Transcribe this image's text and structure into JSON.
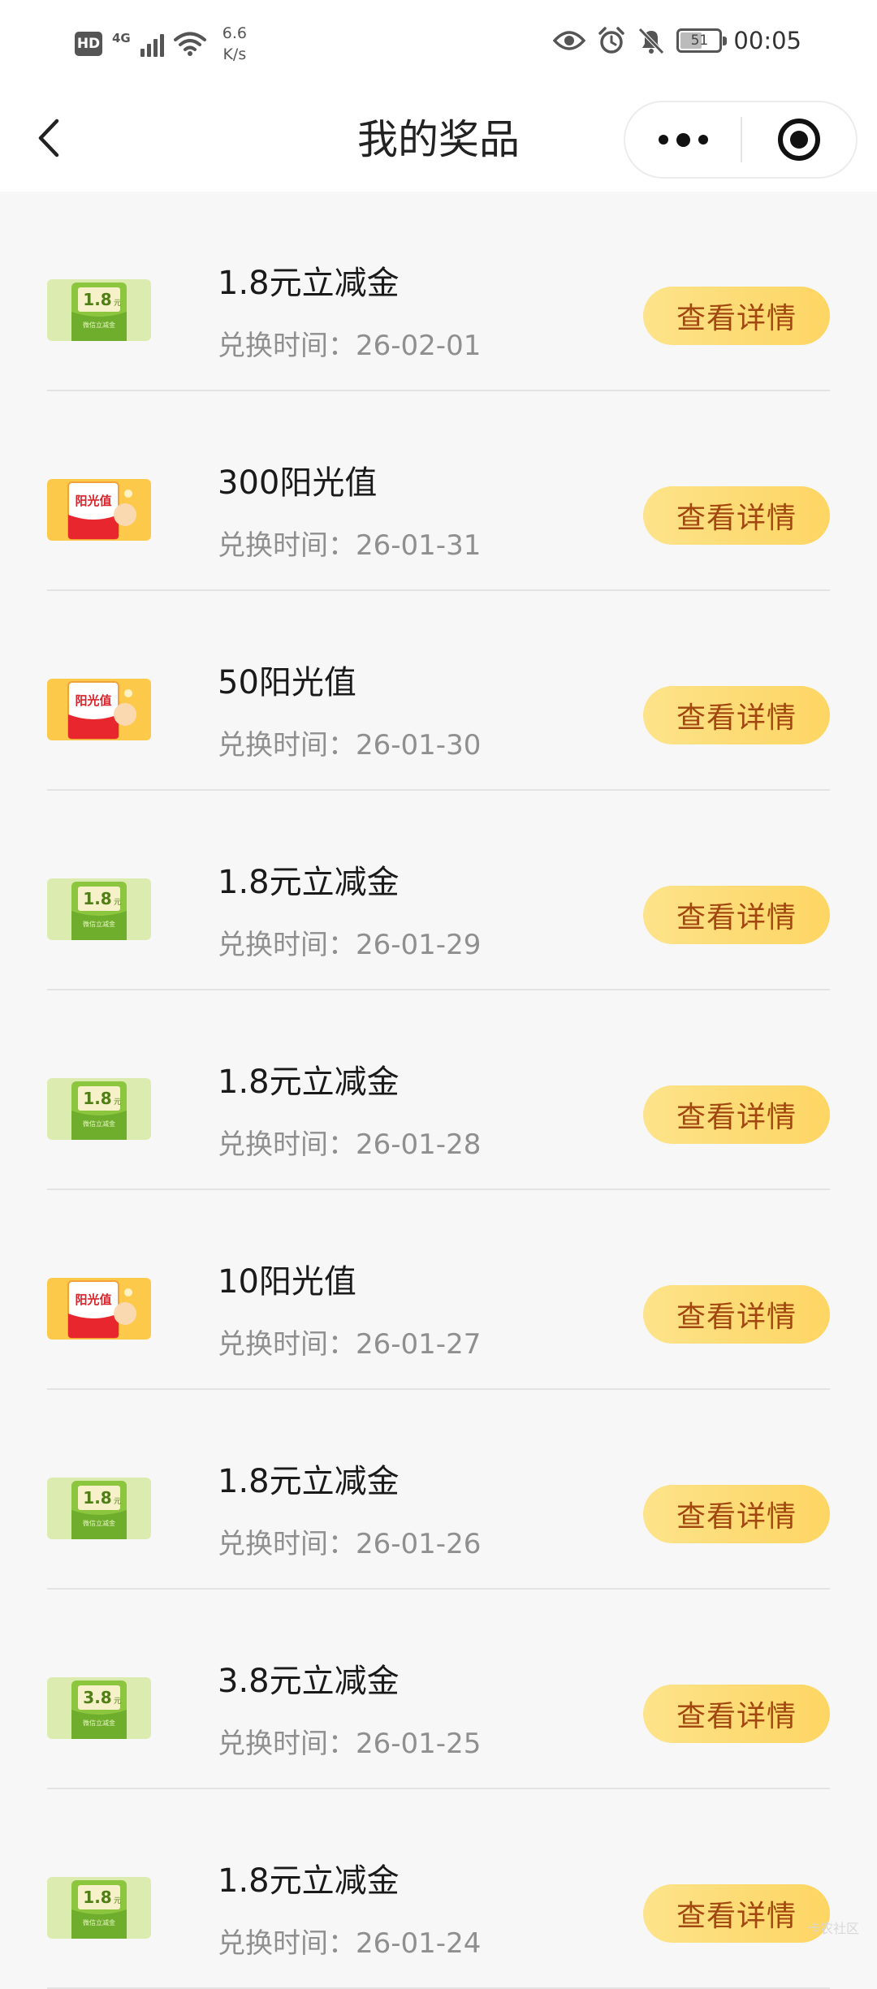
{
  "status_bar": {
    "hd": "HD",
    "network": "4G",
    "speed_value": "6.6",
    "speed_unit": "K/s",
    "battery": "51",
    "time": "00:05"
  },
  "header": {
    "title": "我的奖品"
  },
  "prizes": [
    {
      "title": "1.8元立减金",
      "time": "兑换时间：26-02-01",
      "kind": "voucher",
      "amount": "1.8",
      "unit": "元",
      "sub": "微信立减金",
      "button": "查看详情"
    },
    {
      "title": "300阳光值",
      "time": "兑换时间：26-01-31",
      "kind": "sunshine",
      "label": "阳光值",
      "button": "查看详情"
    },
    {
      "title": "50阳光值",
      "time": "兑换时间：26-01-30",
      "kind": "sunshine",
      "label": "阳光值",
      "button": "查看详情"
    },
    {
      "title": "1.8元立减金",
      "time": "兑换时间：26-01-29",
      "kind": "voucher",
      "amount": "1.8",
      "unit": "元",
      "sub": "微信立减金",
      "button": "查看详情"
    },
    {
      "title": "1.8元立减金",
      "time": "兑换时间：26-01-28",
      "kind": "voucher",
      "amount": "1.8",
      "unit": "元",
      "sub": "微信立减金",
      "button": "查看详情"
    },
    {
      "title": "10阳光值",
      "time": "兑换时间：26-01-27",
      "kind": "sunshine",
      "label": "阳光值",
      "button": "查看详情"
    },
    {
      "title": "1.8元立减金",
      "time": "兑换时间：26-01-26",
      "kind": "voucher",
      "amount": "1.8",
      "unit": "元",
      "sub": "微信立减金",
      "button": "查看详情"
    },
    {
      "title": "3.8元立减金",
      "time": "兑换时间：26-01-25",
      "kind": "voucher",
      "amount": "3.8",
      "unit": "元",
      "sub": "微信立减金",
      "button": "查看详情"
    },
    {
      "title": "1.8元立减金",
      "time": "兑换时间：26-01-24",
      "kind": "voucher",
      "amount": "1.8",
      "unit": "元",
      "sub": "微信立减金",
      "button": "查看详情"
    }
  ],
  "watermark": "卡农社区",
  "colors": {
    "button_bg": "#fdd977",
    "button_text": "#a2470f",
    "voucher_green": "#8cc63f",
    "sunshine_yellow": "#fdc94a",
    "sunshine_red": "#e8262d"
  }
}
